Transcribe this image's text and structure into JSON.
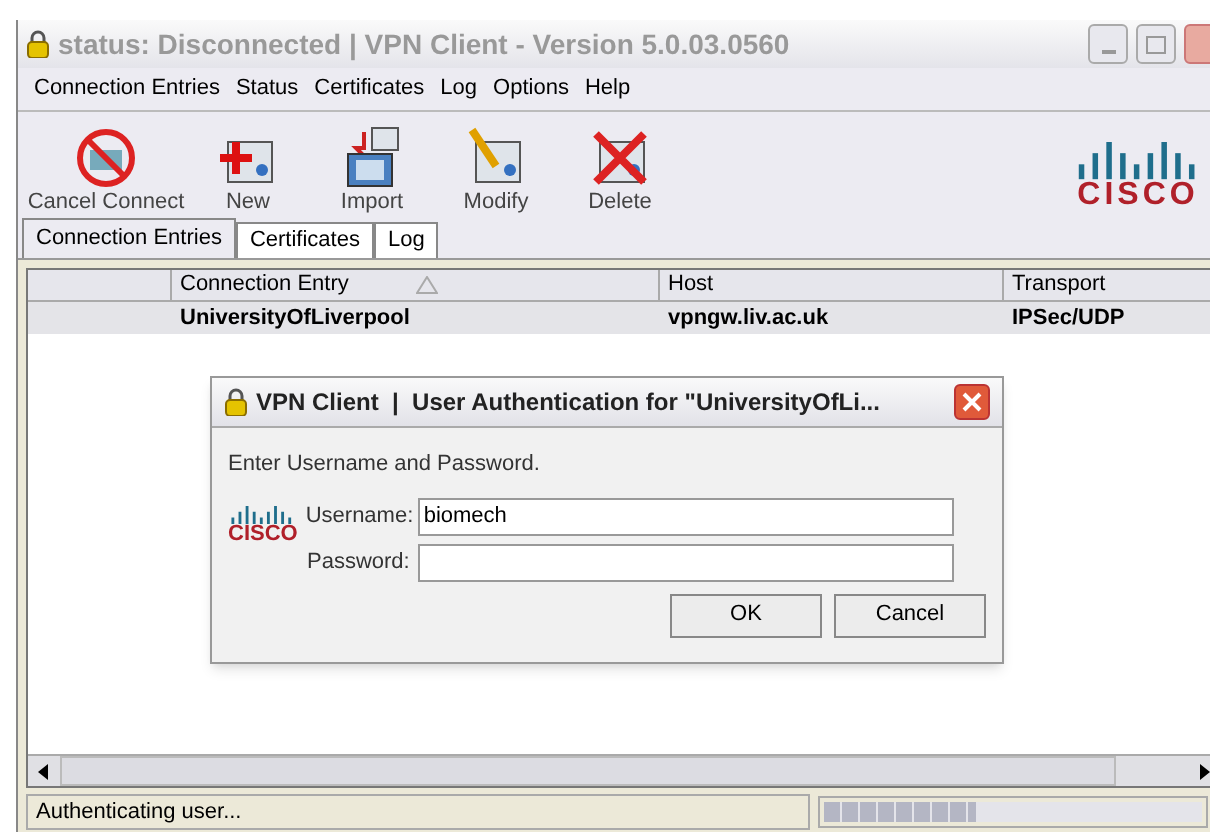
{
  "window": {
    "title": "status: Disconnected | VPN Client - Version 5.0.03.0560"
  },
  "menu": [
    "Connection Entries",
    "Status",
    "Certificates",
    "Log",
    "Options",
    "Help"
  ],
  "toolbar": [
    {
      "label": "Cancel Connect",
      "kind": "cancel"
    },
    {
      "label": "New",
      "kind": "new"
    },
    {
      "label": "Import",
      "kind": "import"
    },
    {
      "label": "Modify",
      "kind": "modify"
    },
    {
      "label": "Delete",
      "kind": "delete"
    }
  ],
  "logo_text": "CISCO",
  "tabs": [
    {
      "label": "Connection Entries",
      "selected": true
    },
    {
      "label": "Certificates",
      "selected": false
    },
    {
      "label": "Log",
      "selected": false
    }
  ],
  "table": {
    "columns": [
      "Connection Entry",
      "Host",
      "Transport"
    ],
    "rows": [
      [
        "UniversityOfLiverpool",
        "vpngw.liv.ac.uk",
        "IPSec/UDP"
      ]
    ]
  },
  "dialog": {
    "title": "VPN Client  |  User Authentication for \"UniversityOfLi...",
    "prompt": "Enter Username and Password.",
    "logo_text": "CISCO",
    "fields": [
      {
        "label": "Username:",
        "value": "biomech"
      },
      {
        "label": "Password:"
      }
    ],
    "buttons": [
      "OK",
      "Cancel"
    ]
  },
  "status_bar": {
    "text": "Authenticating user...",
    "level": 0.4
  }
}
